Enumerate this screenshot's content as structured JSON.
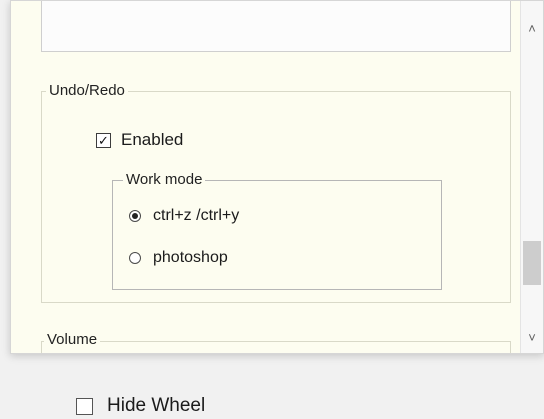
{
  "undo_redo": {
    "title": "Undo/Redo",
    "enabled_label": "Enabled",
    "enabled_checked": true,
    "work_mode": {
      "title": "Work mode",
      "options": [
        "ctrl+z /ctrl+y",
        "photoshop"
      ],
      "selected": "ctrl+z /ctrl+y"
    }
  },
  "volume": {
    "title": "Volume"
  },
  "scroll": {
    "up_icon": "chevron-up-icon",
    "down_icon": "chevron-down-icon"
  },
  "footer": {
    "hide_wheel_label": "Hide Wheel",
    "hide_wheel_checked": false
  },
  "colors": {
    "panel_bg": "#fdfdf0",
    "window_bg": "#f1f1f1"
  }
}
